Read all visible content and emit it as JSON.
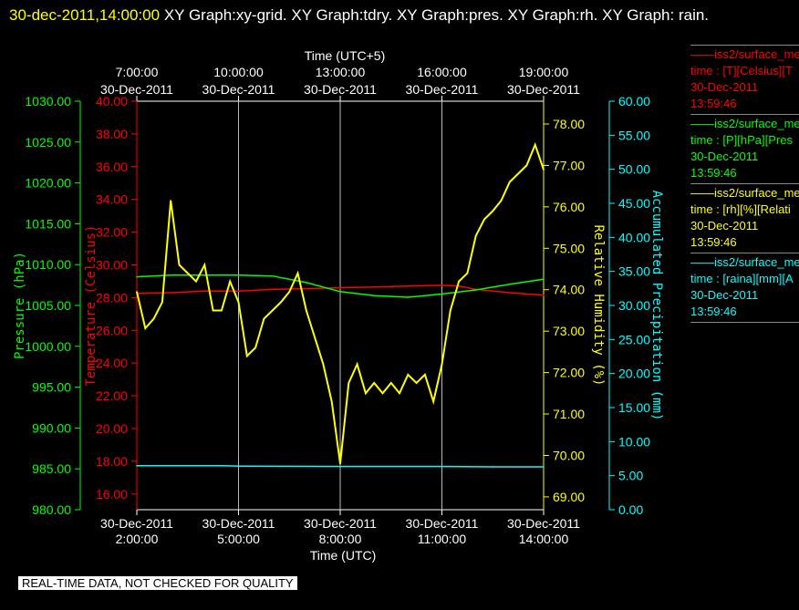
{
  "title": {
    "timestamp": "30-dec-2011,14:00:00",
    "rest": "XY Graph:xy-grid.  XY Graph:tdry.  XY Graph:pres.  XY Graph:rh.  XY Graph: rain."
  },
  "legend": [
    {
      "line1": "iss2/surface_me",
      "line2": "time : [T][Celsius][T",
      "line3": "30-Dec-2011",
      "line4": "13:59:46",
      "color": "#ff0000"
    },
    {
      "line1": "iss2/surface_me",
      "line2": "time : [P][hPa][Pres",
      "line3": "30-Dec-2011",
      "line4": "13:59:46",
      "color": "#00ff00"
    },
    {
      "line1": "iss2/surface_me",
      "line2": "time : [rh][%][Relati",
      "line3": "30-Dec-2011",
      "line4": "13:59:46",
      "color": "#ffff00"
    },
    {
      "line1": "iss2/surface_me",
      "line2": "time : [raina][mm][A",
      "line3": "30-Dec-2011",
      "line4": "13:59:46",
      "color": "#00ffff"
    }
  ],
  "footer": "REAL-TIME DATA, NOT CHECKED FOR QUALITY",
  "chart_data": {
    "type": "line",
    "xlabel": "Time (UTC)",
    "x2label": "Time (UTC+5)",
    "xlim": [
      "2011-12-30 02:00",
      "2011-12-30 14:00"
    ],
    "xticks_bottom": [
      {
        "date": "30-Dec-2011",
        "time": "2:00:00"
      },
      {
        "date": "30-Dec-2011",
        "time": "5:00:00"
      },
      {
        "date": "30-Dec-2011",
        "time": "8:00:00"
      },
      {
        "date": "30-Dec-2011",
        "time": "11:00:00"
      },
      {
        "date": "30-Dec-2011",
        "time": "14:00:00"
      }
    ],
    "xticks_top": [
      {
        "date": "30-Dec-2011",
        "time": "7:00:00"
      },
      {
        "date": "30-Dec-2011",
        "time": "10:00:00"
      },
      {
        "date": "30-Dec-2011",
        "time": "13:00:00"
      },
      {
        "date": "30-Dec-2011",
        "time": "16:00:00"
      },
      {
        "date": "30-Dec-2011",
        "time": "19:00:00"
      }
    ],
    "grid": "vertical lines at bottom-axis ticks",
    "axes": {
      "pressure": {
        "label": "Pressure (hPa)",
        "ylim": [
          980,
          1030
        ],
        "ticks": [
          "980.00",
          "985.00",
          "990.00",
          "995.00",
          "1000.00",
          "1005.00",
          "1010.00",
          "1015.00",
          "1020.00",
          "1025.00",
          "1030.00"
        ],
        "color": "#00ff00"
      },
      "temperature": {
        "label": "Temperature (Celsius)",
        "ylim": [
          15.04,
          40
        ],
        "ticks": [
          "16.00",
          "18.00",
          "20.00",
          "22.00",
          "24.00",
          "26.00",
          "28.00",
          "30.00",
          "32.00",
          "34.00",
          "36.00",
          "38.00",
          "40.00"
        ],
        "color": "#ff0000"
      },
      "rh": {
        "label": "Relative Humidity (%)",
        "ylim": [
          68.69,
          78.55
        ],
        "ticks": [
          "69.00",
          "70.00",
          "71.00",
          "72.00",
          "73.00",
          "74.00",
          "75.00",
          "76.00",
          "77.00",
          "78.00"
        ],
        "color": "#ffff00"
      },
      "precip": {
        "label": "Accumulated Precipitation (mm)",
        "ylim": [
          0,
          60
        ],
        "ticks": [
          "0.00",
          "5.00",
          "10.00",
          "15.00",
          "20.00",
          "25.00",
          "30.00",
          "35.00",
          "40.00",
          "45.00",
          "50.00",
          "55.00",
          "60.00"
        ],
        "color": "#00ffff"
      }
    },
    "series": [
      {
        "axis": "temperature",
        "color": "#ff0000",
        "x": [
          2,
          3,
          4,
          5,
          6,
          7,
          8,
          9,
          10,
          11,
          11.5,
          12,
          13,
          14
        ],
        "values": [
          28.25,
          28.3,
          28.4,
          28.4,
          28.5,
          28.55,
          28.6,
          28.65,
          28.7,
          28.75,
          28.7,
          28.5,
          28.3,
          28.15
        ]
      },
      {
        "axis": "pressure",
        "color": "#00ff00",
        "x": [
          2,
          3,
          4,
          5,
          6,
          7,
          8,
          9,
          10,
          11,
          12,
          13,
          14
        ],
        "values": [
          1008.5,
          1008.7,
          1008.7,
          1008.7,
          1008.6,
          1007.8,
          1006.7,
          1006.2,
          1006.0,
          1006.4,
          1006.9,
          1007.6,
          1008.2
        ]
      },
      {
        "axis": "rh",
        "color": "#ffff00",
        "x": [
          2,
          2.25,
          2.5,
          2.75,
          3,
          3.25,
          3.5,
          3.75,
          4,
          4.25,
          4.5,
          4.75,
          5,
          5.25,
          5.5,
          5.75,
          6,
          6.25,
          6.5,
          6.75,
          7,
          7.25,
          7.5,
          7.75,
          8,
          8.25,
          8.5,
          8.75,
          9,
          9.25,
          9.5,
          9.75,
          10,
          10.25,
          10.5,
          10.75,
          11,
          11.25,
          11.5,
          11.75,
          12,
          12.25,
          12.5,
          12.75,
          13,
          13.25,
          13.5,
          13.75,
          14
        ],
        "values": [
          73.95,
          73.07,
          73.3,
          73.7,
          76.15,
          74.6,
          74.4,
          74.2,
          74.6,
          73.5,
          73.5,
          74.2,
          73.7,
          72.4,
          72.6,
          73.3,
          73.5,
          73.7,
          73.95,
          74.4,
          73.5,
          72.85,
          72.2,
          71.3,
          69.8,
          71.75,
          72.2,
          71.5,
          71.75,
          71.5,
          71.75,
          71.5,
          71.95,
          71.75,
          71.95,
          71.3,
          72.2,
          73.5,
          74.2,
          74.4,
          75.3,
          75.7,
          75.9,
          76.15,
          76.6,
          76.8,
          77.0,
          77.5,
          76.9
        ]
      },
      {
        "axis": "precip",
        "color": "#00ffff",
        "x": [
          2,
          4.5,
          5,
          8,
          11,
          12.5,
          14
        ],
        "values": [
          6.45,
          6.45,
          6.4,
          6.35,
          6.35,
          6.3,
          6.3
        ]
      }
    ]
  }
}
